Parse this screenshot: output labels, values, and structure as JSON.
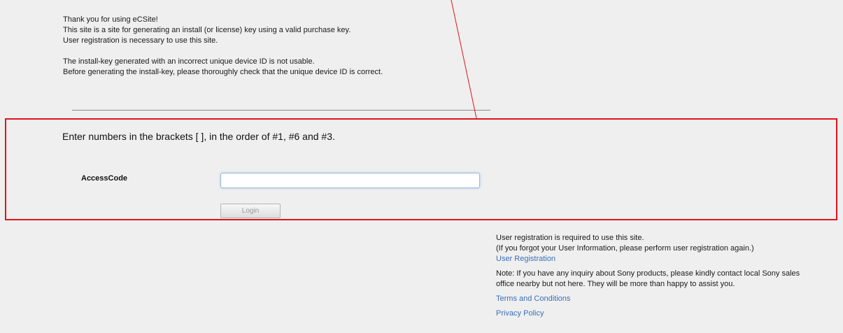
{
  "intro": {
    "line1": "Thank you for using eCSite!",
    "line2": "This site is a site for generating an install (or license) key using a valid purchase key.",
    "line3": "User registration is necessary to use this site.",
    "line4": "The install-key generated with an incorrect unique device ID is not usable.",
    "line5": "Before generating the install-key, please thoroughly check that the unique device ID is correct."
  },
  "login": {
    "instruction": "Enter numbers in the brackets [ ], in the order of #1, #6 and #3.",
    "access_code_label": "AccessCode",
    "access_code_value": "",
    "login_button": "Login"
  },
  "side": {
    "reg_required": "User registration is required to use this site.",
    "forgot_note": "(If you forgot your User Information, please perform user registration again.)",
    "user_registration_link": "User Registration",
    "inquiry_line1": "Note: If you have any inquiry about Sony products, please kindly contact local Sony sales",
    "inquiry_line2": "office nearby but not here. They will be more than happy to assist you.",
    "terms_link": "Terms and Conditions",
    "privacy_link": "Privacy Policy"
  },
  "colors": {
    "annotation_red": "#e0141b",
    "link_blue": "#3a6fb8",
    "panel_gray": "#efefef"
  }
}
